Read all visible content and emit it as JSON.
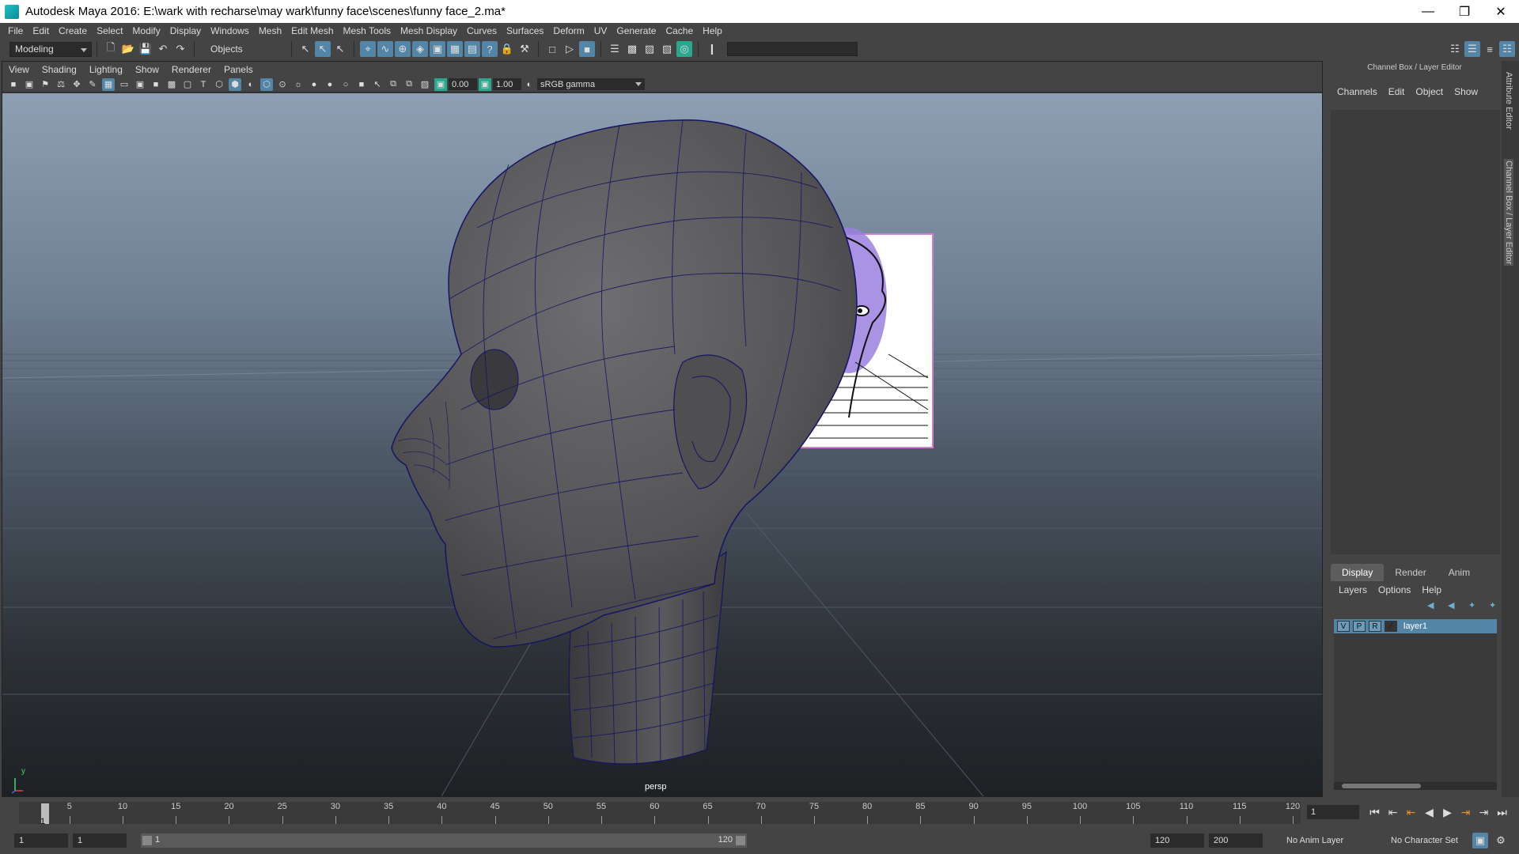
{
  "window": {
    "title": "Autodesk Maya 2016: E:\\wark with recharse\\may wark\\funny face\\scenes\\funny face_2.ma*"
  },
  "menubar": [
    "File",
    "Edit",
    "Create",
    "Select",
    "Modify",
    "Display",
    "Windows",
    "Mesh",
    "Edit Mesh",
    "Mesh Tools",
    "Mesh Display",
    "Curves",
    "Surfaces",
    "Deform",
    "UV",
    "Generate",
    "Cache",
    "Help"
  ],
  "statusline": {
    "mode": "Modeling",
    "objects_label": "Objects"
  },
  "panel": {
    "menus": [
      "View",
      "Shading",
      "Lighting",
      "Show",
      "Renderer",
      "Panels"
    ],
    "exposure": "0.00",
    "gamma": "1.00",
    "color_space": "sRGB gamma",
    "camera_label": "persp",
    "axis_label": "y"
  },
  "channel_box": {
    "title": "Channel Box / Layer Editor",
    "menus": [
      "Channels",
      "Edit",
      "Object",
      "Show"
    ],
    "tabs": [
      "Display",
      "Render",
      "Anim"
    ],
    "active_tab": "Display",
    "layer_menus": [
      "Layers",
      "Options",
      "Help"
    ],
    "layer": {
      "v": "V",
      "p": "P",
      "r": "R",
      "name": "layer1"
    }
  },
  "side_tabs": [
    "Attribute Editor",
    "Channel Box / Layer Editor"
  ],
  "timeline": {
    "ticks": [
      5,
      10,
      15,
      20,
      25,
      30,
      35,
      40,
      45,
      50,
      55,
      60,
      65,
      70,
      75,
      80,
      85,
      90,
      95,
      100,
      105,
      110,
      115,
      120
    ],
    "current": "1",
    "current_field": "1"
  },
  "range": {
    "start": "1",
    "playback_start": "1",
    "range_start_label": "1",
    "range_end_label": "120",
    "playback_end": "120",
    "end": "200",
    "anim_layer": "No Anim Layer",
    "character_set": "No Character Set"
  },
  "colors": {
    "accent": "#5285a6",
    "wireframe": "#141466",
    "image_plane_tint": "#9b7fe0"
  },
  "icons": [
    "new-scene-icon",
    "open-scene-icon",
    "save-scene-icon",
    "undo-icon",
    "redo-icon",
    "select-tool-icon",
    "lasso-icon",
    "paint-select-icon",
    "snap-grid-icon",
    "snap-curve-icon",
    "snap-point-icon",
    "render-icon",
    "ipr-icon",
    "render-settings-icon",
    "camera-icon",
    "grid-icon",
    "wireframe-icon",
    "smooth-shade-icon",
    "play-icon"
  ]
}
